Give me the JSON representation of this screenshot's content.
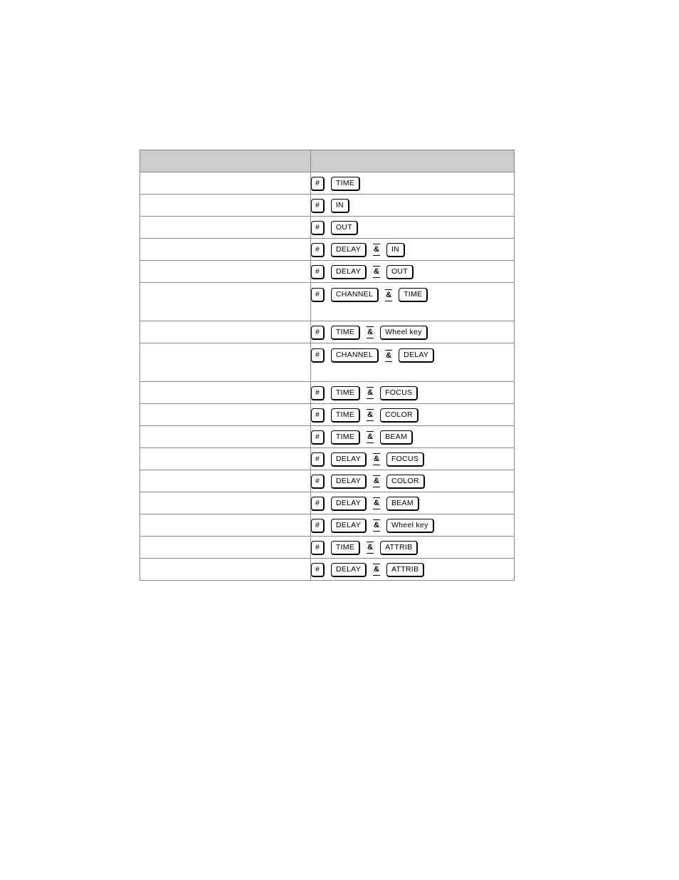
{
  "document": {
    "background_color": "#ffffff",
    "link_color": "#0000cc",
    "header_fill": "#cccccc",
    "border_color": "#8a8a8a"
  },
  "top_link": {
    "label": "",
    "name": "page-top-link"
  },
  "table": {
    "columns": [
      {
        "header": ""
      },
      {
        "header": ""
      }
    ],
    "rows": [
      {
        "description": "",
        "tall": false,
        "keys": [
          {
            "type": "key",
            "label": "#"
          },
          {
            "type": "key",
            "label": "TIME"
          }
        ]
      },
      {
        "description": "",
        "tall": false,
        "keys": [
          {
            "type": "key",
            "label": "#"
          },
          {
            "type": "key",
            "label": "IN"
          }
        ]
      },
      {
        "description": "",
        "tall": false,
        "keys": [
          {
            "type": "key",
            "label": "#"
          },
          {
            "type": "key",
            "label": "OUT"
          }
        ]
      },
      {
        "description": "",
        "tall": false,
        "keys": [
          {
            "type": "key",
            "label": "#"
          },
          {
            "type": "key",
            "label": "DELAY"
          },
          {
            "type": "amp",
            "label": "&"
          },
          {
            "type": "key",
            "label": "IN"
          }
        ]
      },
      {
        "description": "",
        "tall": false,
        "keys": [
          {
            "type": "key",
            "label": "#"
          },
          {
            "type": "key",
            "label": "DELAY"
          },
          {
            "type": "amp",
            "label": "&"
          },
          {
            "type": "key",
            "label": "OUT"
          }
        ]
      },
      {
        "description": "",
        "tall": true,
        "keys": [
          {
            "type": "key",
            "label": "#"
          },
          {
            "type": "key",
            "label": "CHANNEL"
          },
          {
            "type": "amp",
            "label": "&"
          },
          {
            "type": "key",
            "label": "TIME"
          }
        ]
      },
      {
        "description": "",
        "tall": false,
        "keys": [
          {
            "type": "key",
            "label": "#"
          },
          {
            "type": "key",
            "label": "TIME"
          },
          {
            "type": "amp",
            "label": "&"
          },
          {
            "type": "key",
            "label": "Wheel key"
          }
        ]
      },
      {
        "description": "",
        "tall": true,
        "keys": [
          {
            "type": "key",
            "label": "#"
          },
          {
            "type": "key",
            "label": "CHANNEL"
          },
          {
            "type": "amp",
            "label": "&"
          },
          {
            "type": "key",
            "label": "DELAY"
          }
        ]
      },
      {
        "description": "",
        "tall": false,
        "keys": [
          {
            "type": "key",
            "label": "#"
          },
          {
            "type": "key",
            "label": "TIME"
          },
          {
            "type": "amp",
            "label": "&"
          },
          {
            "type": "key",
            "label": "FOCUS"
          }
        ]
      },
      {
        "description": "",
        "tall": false,
        "keys": [
          {
            "type": "key",
            "label": "#"
          },
          {
            "type": "key",
            "label": "TIME"
          },
          {
            "type": "amp",
            "label": "&"
          },
          {
            "type": "key",
            "label": "COLOR"
          }
        ]
      },
      {
        "description": "",
        "tall": false,
        "keys": [
          {
            "type": "key",
            "label": "#"
          },
          {
            "type": "key",
            "label": "TIME"
          },
          {
            "type": "amp",
            "label": "&"
          },
          {
            "type": "key",
            "label": "BEAM"
          }
        ]
      },
      {
        "description": "",
        "tall": false,
        "keys": [
          {
            "type": "key",
            "label": "#"
          },
          {
            "type": "key",
            "label": "DELAY"
          },
          {
            "type": "amp",
            "label": "&"
          },
          {
            "type": "key",
            "label": "FOCUS"
          }
        ]
      },
      {
        "description": "",
        "tall": false,
        "keys": [
          {
            "type": "key",
            "label": "#"
          },
          {
            "type": "key",
            "label": "DELAY"
          },
          {
            "type": "amp",
            "label": "&"
          },
          {
            "type": "key",
            "label": "COLOR"
          }
        ]
      },
      {
        "description": "",
        "tall": false,
        "keys": [
          {
            "type": "key",
            "label": "#"
          },
          {
            "type": "key",
            "label": "DELAY"
          },
          {
            "type": "amp",
            "label": "&"
          },
          {
            "type": "key",
            "label": "BEAM"
          }
        ]
      },
      {
        "description": "",
        "tall": false,
        "keys": [
          {
            "type": "key",
            "label": "#"
          },
          {
            "type": "key",
            "label": "DELAY"
          },
          {
            "type": "amp",
            "label": "&"
          },
          {
            "type": "key",
            "label": "Wheel key"
          }
        ]
      },
      {
        "description": "",
        "tall": false,
        "keys": [
          {
            "type": "key",
            "label": "#"
          },
          {
            "type": "key",
            "label": "TIME"
          },
          {
            "type": "amp",
            "label": "&"
          },
          {
            "type": "key",
            "label": "ATTRIB"
          }
        ]
      },
      {
        "description": "",
        "tall": false,
        "keys": [
          {
            "type": "key",
            "label": "#"
          },
          {
            "type": "key",
            "label": "DELAY"
          },
          {
            "type": "amp",
            "label": "&"
          },
          {
            "type": "key",
            "label": "ATTRIB"
          }
        ]
      }
    ]
  }
}
